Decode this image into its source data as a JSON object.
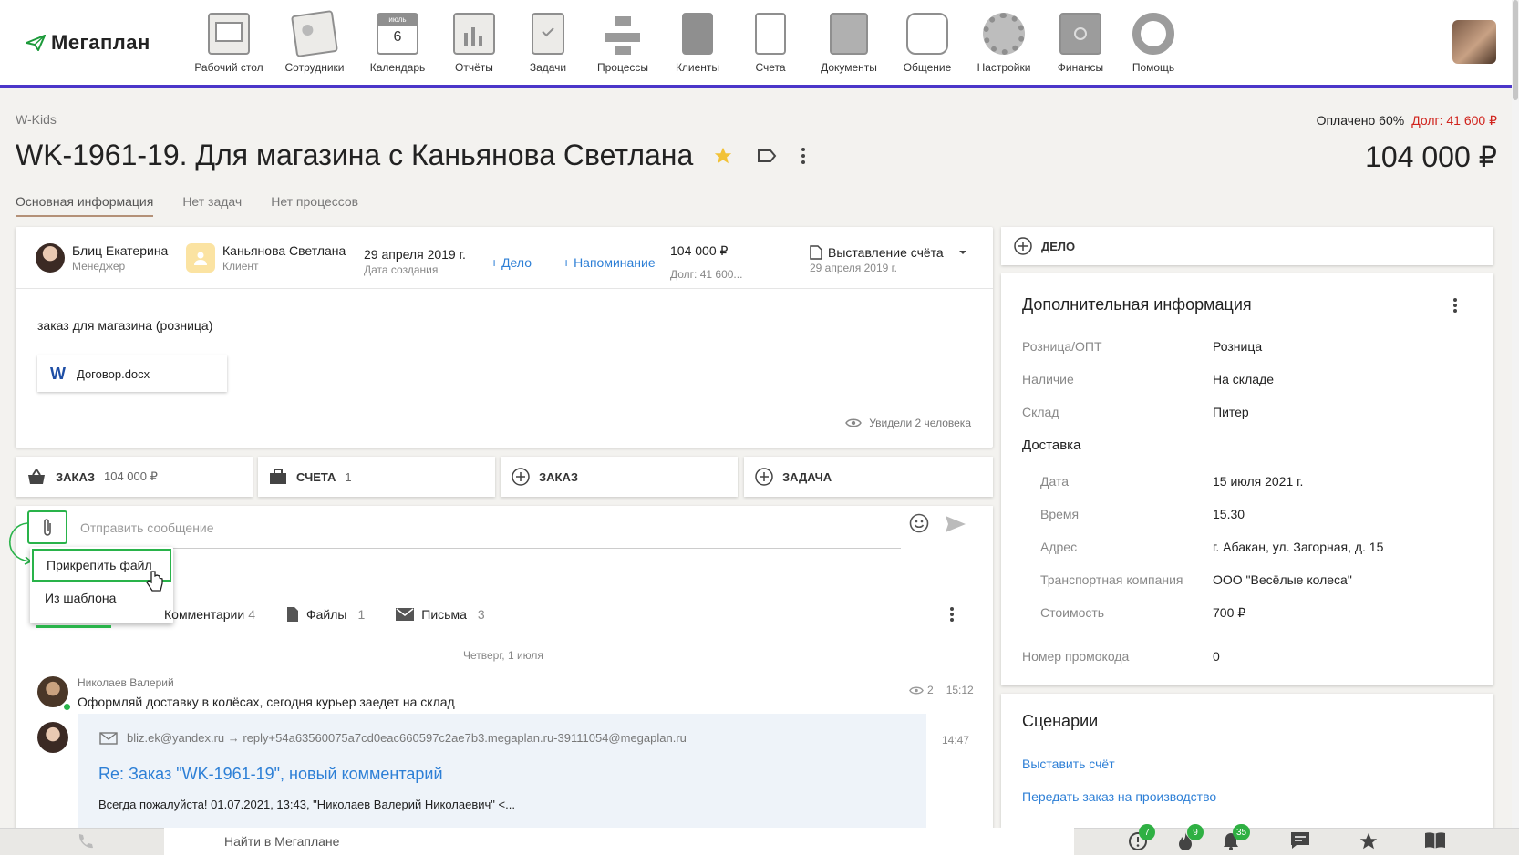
{
  "brand": {
    "logo_text": "Мегаплан"
  },
  "nav": [
    {
      "label": "Рабочий стол",
      "icon": "desktop-icon"
    },
    {
      "label": "Сотрудники",
      "icon": "employees-icon"
    },
    {
      "label": "Календарь",
      "icon": "calendar-icon",
      "calendar_month": "июль",
      "calendar_day": "6"
    },
    {
      "label": "Отчёты",
      "icon": "reports-icon"
    },
    {
      "label": "Задачи",
      "icon": "tasks-icon"
    },
    {
      "label": "Процессы",
      "icon": "processes-icon"
    },
    {
      "label": "Клиенты",
      "icon": "clients-icon"
    },
    {
      "label": "Счета",
      "icon": "invoices-icon"
    },
    {
      "label": "Документы",
      "icon": "documents-icon"
    },
    {
      "label": "Общение",
      "icon": "chat-icon"
    },
    {
      "label": "Настройки",
      "icon": "settings-icon"
    },
    {
      "label": "Финансы",
      "icon": "finance-icon"
    },
    {
      "label": "Помощь",
      "icon": "help-icon"
    }
  ],
  "breadcrumb": "W-Kids",
  "payment": {
    "paid": "Оплачено 60%",
    "debt": "Долг: 41 600 ₽"
  },
  "deal": {
    "title": "WK-1961-19. Для магазина с Каньянова Светлана",
    "amount": "104 000 ₽"
  },
  "tabs": [
    "Основная информация",
    "Нет задач",
    "Нет процессов"
  ],
  "info": {
    "manager_name": "Блиц Екатерина",
    "manager_role": "Менеджер",
    "client_name": "Каньянова Светлана",
    "client_role": "Клиент",
    "created_date": "29 апреля 2019 г.",
    "created_label": "Дата создания",
    "add_action": "+ Дело",
    "add_reminder": "+ Напоминание",
    "sum": "104 000 ₽",
    "debt_short": "Долг: 41 600...",
    "stage": "Выставление счёта",
    "stage_date": "29 апреля 2019 г.",
    "description": "заказ для магазина (розница)",
    "file_name": "Договор.docx",
    "seen": "Увидели 2 человека"
  },
  "actions": [
    {
      "label": "ЗАКАЗ",
      "count": "104 000 ₽",
      "icon": "basket-icon"
    },
    {
      "label": "СЧЕТА",
      "count": "1",
      "icon": "briefcase-icon"
    },
    {
      "label": "ЗАКАЗ",
      "count": "",
      "icon": "plus-circle-icon"
    },
    {
      "label": "ЗАДАЧА",
      "count": "",
      "icon": "plus-circle-icon"
    }
  ],
  "composer": {
    "placeholder": "Отправить сообщение"
  },
  "attach_menu": [
    "Прикрепить файл",
    "Из шаблона"
  ],
  "feed_tabs": [
    {
      "label": "Комментарии",
      "count": "4"
    },
    {
      "label": "Файлы",
      "count": "1"
    },
    {
      "label": "Письма",
      "count": "3"
    }
  ],
  "feed": {
    "day": "Четверг, 1 июля",
    "comment_author": "Николаев Валерий",
    "comment_text": "Оформляй доставку в колёсах, сегодня курьер заедет на склад",
    "comment_views": "2",
    "comment_time": "15:12",
    "mail_route": "bliz.ek@yandex.ru → reply+54a63560075a7cd0eac660597c2ae7b3.megaplan.ru-39111054@megaplan.ru",
    "mail_time": "14:47",
    "mail_subject": "Re: Заказ \"WK-1961-19\", новый комментарий",
    "mail_preview": "Всегда пожалуйста!  01.07.2021, 13:43, \"Николаев Валерий Николаевич\" <..."
  },
  "side": {
    "delo_label": "ДЕЛО",
    "extra_title": "Дополнительная информация",
    "fields": [
      {
        "k": "Розница/ОПТ",
        "v": "Розница"
      },
      {
        "k": "Наличие",
        "v": "На складе"
      },
      {
        "k": "Склад",
        "v": "Питер"
      }
    ],
    "delivery_title": "Доставка",
    "delivery": [
      {
        "k": "Дата",
        "v": "15 июля 2021 г."
      },
      {
        "k": "Время",
        "v": "15.30"
      },
      {
        "k": "Адрес",
        "v": "г. Абакан, ул. Загорная, д. 15"
      },
      {
        "k": "Транспортная компания",
        "v": "ООО \"Весёлые колеса\""
      },
      {
        "k": "Стоимость",
        "v": "700 ₽"
      }
    ],
    "promo": {
      "k": "Номер промокода",
      "v": "0"
    },
    "scenarios_title": "Сценарии",
    "scenarios": [
      "Выставить счёт",
      "Передать заказ на производство"
    ]
  },
  "bottom": {
    "search": "Найти в Мегаплане",
    "badges": {
      "alerts": "7",
      "hot": "9",
      "notifications": "35"
    }
  },
  "colors": {
    "accent": "#4b36c9",
    "link": "#2d7fd6",
    "debt": "#d0231c",
    "green": "#29b34a"
  }
}
